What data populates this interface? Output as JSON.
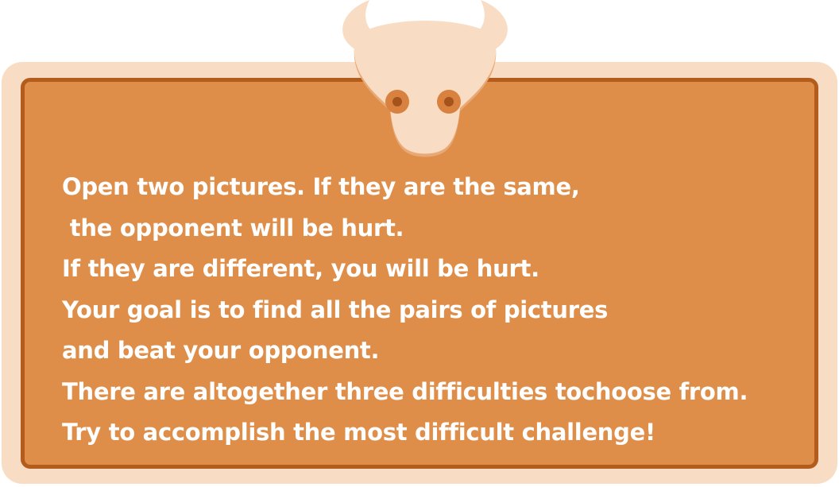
{
  "dialog": {
    "instruction_lines": [
      "Open two pictures. If they are the same,",
      " the opponent will be hurt.",
      "If they are different, you will be hurt.",
      "Your goal is to find all the pairs of pictures",
      "and beat your opponent.",
      "There are altogether three difficulties tochoose from.",
      "Try to accomplish the most difficult challenge!"
    ]
  },
  "colors": {
    "panel_fill": "#de8e49",
    "panel_border": "#b35c1c",
    "outer_frame": "#f8dcc3",
    "bull_head": "#f8dcc3",
    "bull_eye_ring": "#d9813f",
    "bull_pupil": "#a4531a",
    "text": "#ffffff"
  }
}
